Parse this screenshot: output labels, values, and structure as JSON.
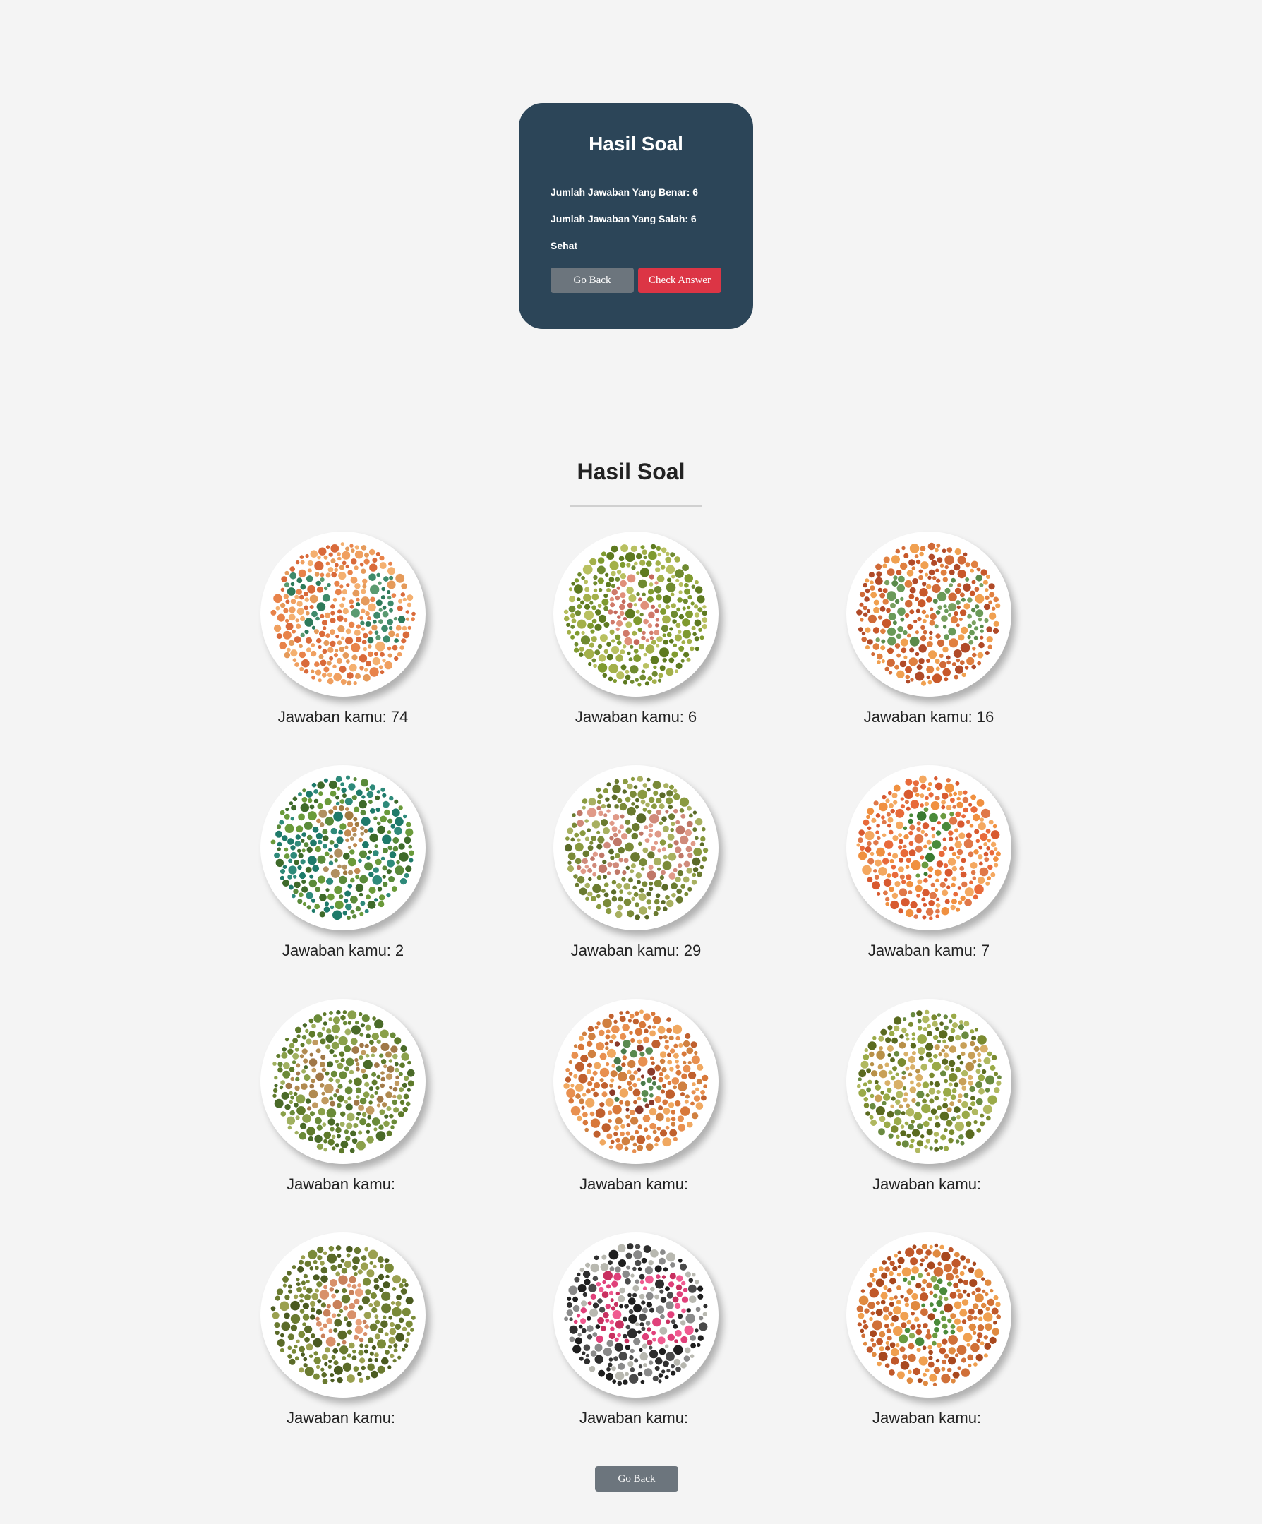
{
  "summary": {
    "title": "Hasil Soal",
    "correct": "Jumlah Jawaban Yang Benar: 6",
    "wrong": "Jumlah Jawaban Yang Salah: 6",
    "status": "Sehat",
    "go_back": "Go Back",
    "check_answer": "Check Answer"
  },
  "results": {
    "title": "Hasil Soal",
    "answer_label": "Jawaban kamu:",
    "items": [
      {
        "answer": "74",
        "plate_number": "74",
        "bg": [
          "#e8834a",
          "#f0a060",
          "#d96a3a",
          "#f4b070",
          "#e59a5a"
        ],
        "fg": [
          "#3e8a6a",
          "#5a9a70",
          "#2e7a5a"
        ]
      },
      {
        "answer": "6",
        "plate_number": "6",
        "bg": [
          "#7f9a2f",
          "#a3b04a",
          "#5e7a20",
          "#b8c060",
          "#6f8a30"
        ],
        "fg": [
          "#d07a6a",
          "#c4685a",
          "#e0907a"
        ]
      },
      {
        "answer": "16",
        "plate_number": "16",
        "bg": [
          "#c8582a",
          "#e08040",
          "#b04a28",
          "#f0a050",
          "#d06a38"
        ],
        "fg": [
          "#5a8a4a",
          "#6a9a58",
          "#7aa060"
        ]
      },
      {
        "answer": "2",
        "plate_number": "2",
        "bg": [
          "#3e6a2a",
          "#5a8a3a",
          "#2e8a7a",
          "#6a9a3a",
          "#1e7a6a"
        ],
        "fg": [
          "#c08a50",
          "#a07a40",
          "#b09060"
        ]
      },
      {
        "answer": "29",
        "plate_number": "29",
        "bg": [
          "#6a7a30",
          "#8a9a40",
          "#5a6a28",
          "#a8b060",
          "#7a8a38"
        ],
        "fg": [
          "#d08a7a",
          "#c07868",
          "#e09a88"
        ]
      },
      {
        "answer": "7",
        "plate_number": "7",
        "bg": [
          "#e86a3a",
          "#f09040",
          "#d85a30",
          "#f4a860",
          "#e07848"
        ],
        "fg": [
          "#4a8a3a",
          "#6a9a40",
          "#3a7a30"
        ]
      },
      {
        "answer": "",
        "plate_number": "45",
        "bg": [
          "#5e7a2a",
          "#8aa04a",
          "#4a6a28",
          "#a0b060",
          "#6a8a38"
        ],
        "fg": [
          "#b08a50",
          "#a07848",
          "#c09a60"
        ]
      },
      {
        "answer": "",
        "plate_number": "5",
        "bg": [
          "#d8783a",
          "#e89050",
          "#c0602e",
          "#f0a860",
          "#d08040"
        ],
        "fg": [
          "#4a7a4a",
          "#5a8a50",
          "#8a3a2a"
        ]
      },
      {
        "answer": "",
        "plate_number": "97",
        "bg": [
          "#7a8a30",
          "#9aaa48",
          "#5a6a20",
          "#b0b860",
          "#6a8a40"
        ],
        "fg": [
          "#c8a058",
          "#b89048",
          "#d8b068"
        ]
      },
      {
        "answer": "",
        "plate_number": "8",
        "bg": [
          "#5a6a28",
          "#7a8a38",
          "#4a5a20",
          "#9aa050",
          "#6a7a30"
        ],
        "fg": [
          "#d8906a",
          "#c8805a",
          "#e8a07a"
        ]
      },
      {
        "answer": "",
        "plate_number": "42",
        "bg": [
          "#1e1e1e",
          "#4a4a4a",
          "#8a8a8a",
          "#b8b8b0",
          "#2e2e2e"
        ],
        "fg": [
          "#e0407a",
          "#c83060",
          "#f05a90"
        ]
      },
      {
        "answer": "",
        "plate_number": "3",
        "bg": [
          "#c0582a",
          "#e08a40",
          "#a8481e",
          "#f0a050",
          "#d07038"
        ],
        "fg": [
          "#6a9a40",
          "#8aaa50",
          "#4a8a3a"
        ]
      }
    ]
  },
  "footer": {
    "go_back": "Go Back"
  }
}
